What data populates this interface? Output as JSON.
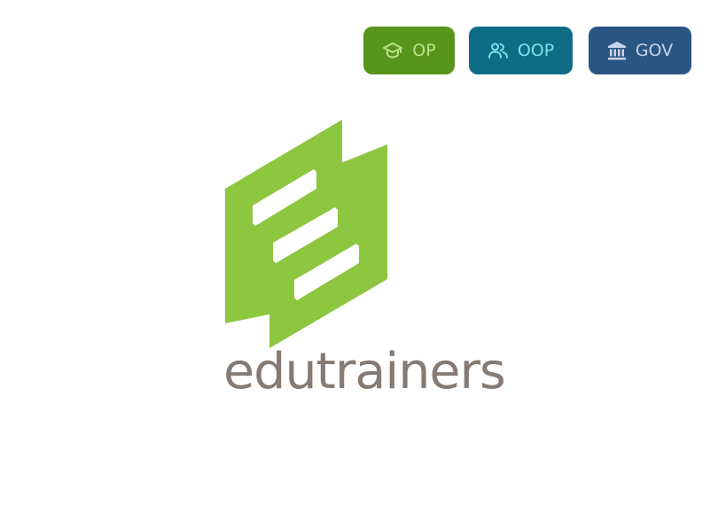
{
  "nav": {
    "op": {
      "label": "OP",
      "icon": "graduation-cap-icon"
    },
    "oop": {
      "label": "OOP",
      "icon": "users-icon"
    },
    "gov": {
      "label": "GOV",
      "icon": "institution-icon"
    }
  },
  "logo": {
    "wordmark": "edutrainers"
  },
  "colors": {
    "op_bg": "#58951c",
    "oop_bg": "#0e6d84",
    "gov_bg": "#2b5583",
    "logo_green": "#8dc63f",
    "wordmark": "#857b74"
  }
}
